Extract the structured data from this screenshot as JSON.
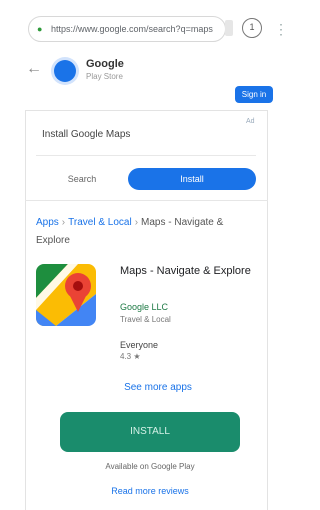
{
  "browser": {
    "url": "https://www.google.com/search?q=maps",
    "tab_count": "1",
    "menu_icon": "more-vert-icon"
  },
  "site": {
    "name": "Google",
    "subtitle": "Play Store",
    "top_button": "Sign in",
    "ad_badge": "Ad"
  },
  "search": {
    "query_label": "Install Google Maps",
    "segment_left": "Search",
    "segment_right": "Install"
  },
  "breadcrumb": {
    "items": [
      "Apps",
      "Travel & Local",
      "Maps - Navigate & Explore"
    ]
  },
  "app": {
    "title": "Maps - Navigate & Explore",
    "developer": "Google LLC",
    "category": "Travel & Local",
    "rating_label": "Everyone",
    "rating_value": "4.3 ★",
    "more_link": "See more apps",
    "install_label": "INSTALL",
    "note": "Available on Google Play",
    "bottom_link": "Read more reviews"
  },
  "colors": {
    "accent": "#1a73e8",
    "install": "#1a8c6c"
  }
}
